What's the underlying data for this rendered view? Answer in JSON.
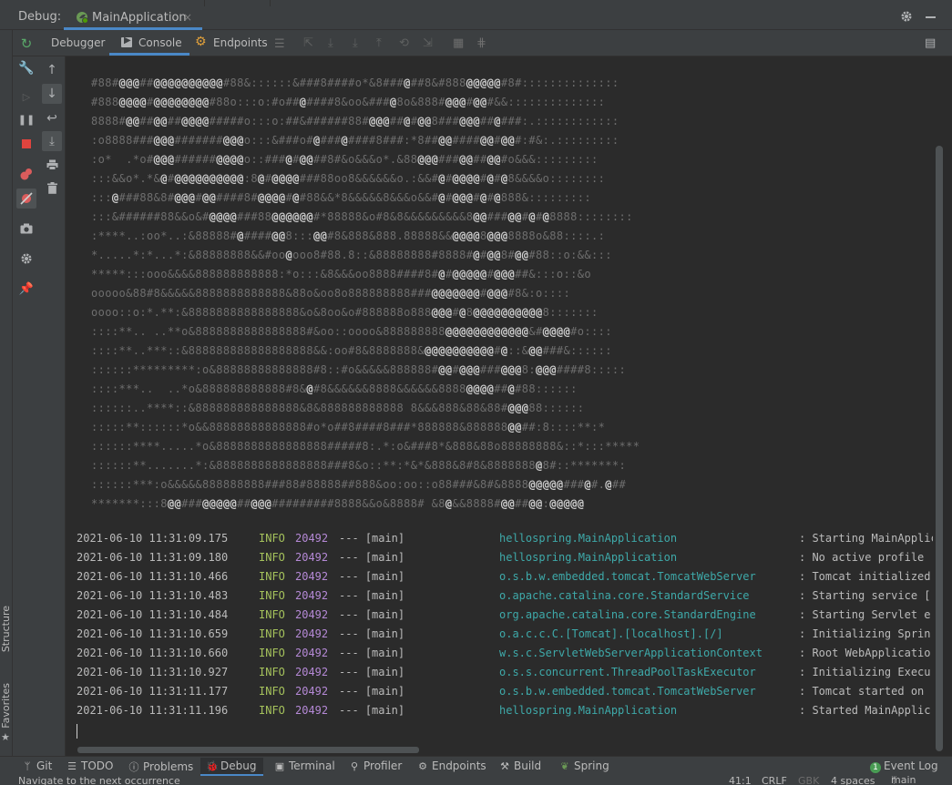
{
  "window": {
    "debug_label": "Debug:",
    "run_config": "MainApplication",
    "close": "×"
  },
  "toolbar": {
    "debugger_tab": "Debugger",
    "console_tab": "Console",
    "endpoints_tab": "Endpoints"
  },
  "left_strip": {
    "structure": "Structure",
    "favorites": "Favorites"
  },
  "console": {
    "ascii_art": [
      "#88#@@@##@@@@@@@@@@#88&::::::&###8####o*&8###@##8&#888@@@@@#8#::::::::::::::",
      "#888@@@@#@@@@@@@@#88o:::o:#o##@####8&oo&###@8o&888#@@@#@@#&&::::::::::::::",
      "8888#@@##@@##@@@@#####o:::o:##&######88#@@@##@#@@8###@@@##@###:.::::::::::::",
      ":o8888###@@@#######@@@o:::&###o#@###@####8###:*8##@@####@@#@@#:#&:.:::::::::",
      ":o*  .*o#@@@######@@@@o::###@#@@##8#&o&&&o*.&88@@@###@@##@@#o&&&:::::::::",
      ":::&&o*.*&@#@@@@@@@@@@:8@#@@@@###88oo8&&&&&&o.:&&#@#@@@@#@#@8&&&&o::::::::",
      ":::@###88&8#@@@#@@####8#@@@@#@#88&&*8&&&&&8&&&o&&#@#@@@#@#@888&:::::::::",
      ":::&######88&&o&#@@@@###88@@@@@@#*88888&o#8&8&&&&&&&&&8@@###@@#@#@8888::::::::",
      ":****..:oo*..:&88888#@####@@8:::@@#8&888&888.88888&&@@@@8@@@8888o&88::::.:",
      "*.....*:*...*:&88888888&&#oo@ooo8#88.8::&88888888#8888#@#@@8#@@#88::o:&&:::",
      "*****:::ooo&&&&888888888888:*o:::&8&&&oo8888####8#@#@@@@@#@@@##&:::o::&o",
      "ooooo&88#8&&&&&8888888888888&88o&oo8o888888888###@@@@@@@#@@@#8&:o::::",
      "oooo::o:*.**:&8888888888888888&o&8oo&o#888888o888@@@#@8@@@@@@@@@@8:::::::",
      "::::**.. ..**o&8888888888888888#&oo::oooo&888888888@@@@@@@@@@@@&#@@@@#o::::",
      "::::**..***::&888888888888888888&&:oo#8&8888888&@@@@@@@@@@#@::&@@###&::::::",
      "::::::*********:o&88888888888888#8::#o&&&&&888888#@@#@@@###@@@8:@@@####8:::::",
      "::::***..  ..*o&888888888888#8&@#8&&&&&&8888&&&&&&8888@@@@##@#88::::::",
      "::::::..****::&888888888888888&8&888888888888 8&&&888&88&88#@@@88::::::",
      ":::::**::::::*o&&88888888888888#o*o##8####8###*888888&888888@@##:8::::**:*",
      "::::::****.....*o&8888888888888888#####8:.*:o&###8*&888&88o88888888&::*:::*****",
      "::::::**.......*:&8888888888888888###8&o::**:*&*&888&8#8&8888888@8#::*******:",
      "::::::***:o&&&&&888888888###88#88888##888&oo:oo::o88###&8#&8888@@@@@###@#.@##",
      "*******:::8@@###@@@@@##@@@#########8888&&o&8888# &8@&&8888#@@##@@:@@@@@"
    ],
    "logs": [
      {
        "ts": "2021-06-10 11:31:09.175",
        "level": "INFO",
        "pid": "20492",
        "sep": "--- [",
        "thread": "main]",
        "logger": "hellospring.MainApplication",
        "msg": ": Starting MainApplic"
      },
      {
        "ts": "2021-06-10 11:31:09.180",
        "level": "INFO",
        "pid": "20492",
        "sep": "--- [",
        "thread": "main]",
        "logger": "hellospring.MainApplication",
        "msg": ": No active profile"
      },
      {
        "ts": "2021-06-10 11:31:10.466",
        "level": "INFO",
        "pid": "20492",
        "sep": "--- [",
        "thread": "main]",
        "logger": "o.s.b.w.embedded.tomcat.TomcatWebServer",
        "msg": ": Tomcat initialized"
      },
      {
        "ts": "2021-06-10 11:31:10.483",
        "level": "INFO",
        "pid": "20492",
        "sep": "--- [",
        "thread": "main]",
        "logger": "o.apache.catalina.core.StandardService",
        "msg": ": Starting service ["
      },
      {
        "ts": "2021-06-10 11:31:10.484",
        "level": "INFO",
        "pid": "20492",
        "sep": "--- [",
        "thread": "main]",
        "logger": "org.apache.catalina.core.StandardEngine",
        "msg": ": Starting Servlet e"
      },
      {
        "ts": "2021-06-10 11:31:10.659",
        "level": "INFO",
        "pid": "20492",
        "sep": "--- [",
        "thread": "main]",
        "logger": "o.a.c.c.C.[Tomcat].[localhost].[/]",
        "msg": ": Initializing Sprin"
      },
      {
        "ts": "2021-06-10 11:31:10.660",
        "level": "INFO",
        "pid": "20492",
        "sep": "--- [",
        "thread": "main]",
        "logger": "w.s.c.ServletWebServerApplicationContext",
        "msg": ": Root WebApplicatio"
      },
      {
        "ts": "2021-06-10 11:31:10.927",
        "level": "INFO",
        "pid": "20492",
        "sep": "--- [",
        "thread": "main]",
        "logger": "o.s.s.concurrent.ThreadPoolTaskExecutor",
        "msg": ": Initializing Execu"
      },
      {
        "ts": "2021-06-10 11:31:11.177",
        "level": "INFO",
        "pid": "20492",
        "sep": "--- [",
        "thread": "main]",
        "logger": "o.s.b.w.embedded.tomcat.TomcatWebServer",
        "msg": ": Tomcat started on"
      },
      {
        "ts": "2021-06-10 11:31:11.196",
        "level": "INFO",
        "pid": "20492",
        "sep": "--- [",
        "thread": "main]",
        "logger": "hellospring.MainApplication",
        "msg": ": Started MainApplic"
      }
    ]
  },
  "bottom_tabs": {
    "git": "Git",
    "todo": "TODO",
    "problems": "Problems",
    "debug": "Debug",
    "terminal": "Terminal",
    "profiler": "Profiler",
    "endpoints": "Endpoints",
    "build": "Build",
    "spring": "Spring",
    "event_log": "Event Log",
    "event_count": "1"
  },
  "status": {
    "message": "Navigate to the next occurrence",
    "position": "41:1",
    "line_sep": "CRLF",
    "encoding": "GBK",
    "indent": "4 spaces",
    "branch": "main"
  },
  "colors": {
    "accent": "#4a88c7",
    "info": "#a5c25c",
    "pid": "#b589d6",
    "logger": "#3ea9a9",
    "art_bright": "#d0d0d0",
    "art_dim": "#6e6e6e"
  }
}
